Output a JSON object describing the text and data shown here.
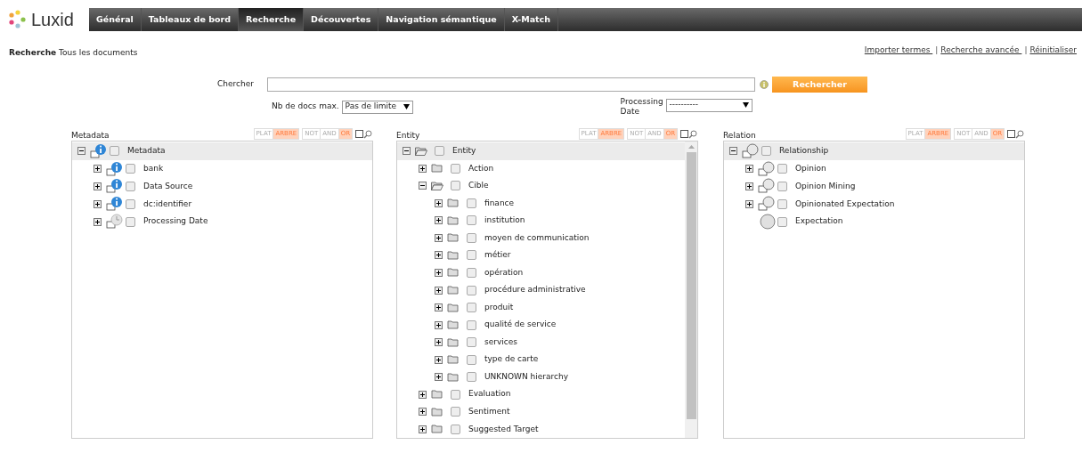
{
  "logo": {
    "text": "Luxid"
  },
  "nav_tabs": [
    {
      "label": "Général",
      "selected": false
    },
    {
      "label": "Tableaux de bord",
      "selected": false
    },
    {
      "label": "Recherche",
      "selected": true
    },
    {
      "label": "Découvertes",
      "selected": false
    },
    {
      "label": "Navigation sémantique",
      "selected": false
    },
    {
      "label": "X-Match",
      "selected": false
    }
  ],
  "breadcrumb": {
    "title": "Recherche",
    "subtitle": "Tous les documents"
  },
  "top_links": [
    {
      "kind": "link",
      "text": "Importer termes "
    },
    {
      "kind": "separator",
      "text": "|"
    },
    {
      "kind": "link",
      "text": "Recherche avancée "
    },
    {
      "kind": "separator",
      "text": "|"
    },
    {
      "kind": "link",
      "text": "Réinitialiser"
    }
  ],
  "search": {
    "label": "Chercher",
    "button": "Rechercher"
  },
  "filters": [
    {
      "label": "Nb de docs max.",
      "value": "Pas de limite"
    },
    {
      "label": "Processing Date",
      "value": "----------"
    }
  ],
  "panels": [
    {
      "title": "Metadata",
      "view_toggles": [
        {
          "label": "PLAT",
          "selected": false
        },
        {
          "label": "ARBRE",
          "selected": true
        }
      ],
      "logic_toggles": [
        {
          "label": "NOT",
          "selected": false
        },
        {
          "label": "AND",
          "selected": false
        },
        {
          "label": "OR",
          "selected": true
        }
      ],
      "scrollbar": false,
      "tree": [
        {
          "label": "Metadata",
          "kind": "info",
          "expanded": true,
          "checked": false,
          "children": [
            {
              "label": "bank",
              "kind": "info",
              "expanded": false,
              "checked": false
            },
            {
              "label": "Data Source",
              "kind": "info",
              "expanded": false,
              "checked": false
            },
            {
              "label": "dc:identifier",
              "kind": "info",
              "expanded": false,
              "checked": false
            },
            {
              "label": "Processing Date",
              "kind": "clock",
              "expanded": false,
              "checked": false
            }
          ]
        }
      ]
    },
    {
      "title": "Entity",
      "view_toggles": [
        {
          "label": "PLAT",
          "selected": false
        },
        {
          "label": "ARBRE",
          "selected": true
        }
      ],
      "logic_toggles": [
        {
          "label": "NOT",
          "selected": false
        },
        {
          "label": "AND",
          "selected": false
        },
        {
          "label": "OR",
          "selected": true
        }
      ],
      "scrollbar": true,
      "tree": [
        {
          "label": "Entity",
          "kind": "folder",
          "expanded": true,
          "checked": false,
          "children": [
            {
              "label": "Action",
              "kind": "folder",
              "expanded": false,
              "checked": false
            },
            {
              "label": "Cible",
              "kind": "folder",
              "expanded": true,
              "checked": false,
              "children": [
                {
                  "label": "finance",
                  "kind": "folder",
                  "expanded": false,
                  "checked": false
                },
                {
                  "label": "institution",
                  "kind": "folder",
                  "expanded": false,
                  "checked": false
                },
                {
                  "label": "moyen de communication",
                  "kind": "folder",
                  "expanded": false,
                  "checked": false
                },
                {
                  "label": "métier",
                  "kind": "folder",
                  "expanded": false,
                  "checked": false
                },
                {
                  "label": "opération",
                  "kind": "folder",
                  "expanded": false,
                  "checked": false
                },
                {
                  "label": "procédure administrative",
                  "kind": "folder",
                  "expanded": false,
                  "checked": false
                },
                {
                  "label": "produit",
                  "kind": "folder",
                  "expanded": false,
                  "checked": false
                },
                {
                  "label": "qualité de service",
                  "kind": "folder",
                  "expanded": false,
                  "checked": false
                },
                {
                  "label": "services",
                  "kind": "folder",
                  "expanded": false,
                  "checked": false
                },
                {
                  "label": "type de carte",
                  "kind": "folder",
                  "expanded": false,
                  "checked": false
                },
                {
                  "label": "UNKNOWN hierarchy",
                  "kind": "folder",
                  "expanded": false,
                  "checked": false
                }
              ]
            },
            {
              "label": "Evaluation",
              "kind": "folder",
              "expanded": false,
              "checked": false
            },
            {
              "label": "Sentiment",
              "kind": "folder",
              "expanded": false,
              "checked": false
            },
            {
              "label": "Suggested Target",
              "kind": "folder",
              "expanded": false,
              "checked": false
            }
          ]
        }
      ]
    },
    {
      "title": "Relation",
      "view_toggles": [
        {
          "label": "PLAT",
          "selected": false
        },
        {
          "label": "ARBRE",
          "selected": true
        }
      ],
      "logic_toggles": [
        {
          "label": "NOT",
          "selected": false
        },
        {
          "label": "AND",
          "selected": false
        },
        {
          "label": "OR",
          "selected": true
        }
      ],
      "scrollbar": false,
      "tree": [
        {
          "label": "Relationship",
          "kind": "bubble",
          "expanded": true,
          "checked": false,
          "children": [
            {
              "label": "Opinion",
              "kind": "bubble",
              "expanded": false,
              "checked": false
            },
            {
              "label": "Opinion Mining",
              "kind": "bubble",
              "expanded": false,
              "checked": false
            },
            {
              "label": "Opinionated Expectation",
              "kind": "bubble",
              "expanded": false,
              "checked": false
            },
            {
              "label": "Expectation",
              "kind": "sphere",
              "checked": false
            }
          ]
        }
      ]
    }
  ]
}
